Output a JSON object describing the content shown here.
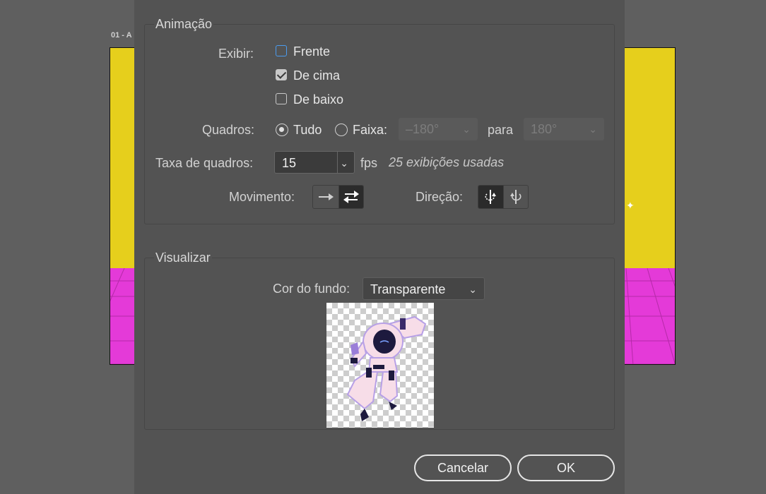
{
  "document": {
    "tab_label": "01 - A"
  },
  "animation": {
    "title": "Animação",
    "show_label": "Exibir:",
    "show_options": [
      {
        "label": "Frente",
        "checked": false
      },
      {
        "label": "De cima",
        "checked": true
      },
      {
        "label": "De baixo",
        "checked": false
      }
    ],
    "frames_label": "Quadros:",
    "frames_all": "Tudo",
    "frames_range": "Faixa:",
    "frames_selected": "Tudo",
    "range_from": "–180°",
    "range_to_label": "para",
    "range_to": "180°",
    "frame_rate_label": "Taxa de quadros:",
    "frame_rate_value": "15",
    "fps_label": "fps",
    "views_used": "25 exibições usadas",
    "motion_label": "Movimento:",
    "motion_options": [
      "arrow-right-icon",
      "swap-arrows-icon"
    ],
    "motion_selected": "swap-arrows-icon",
    "direction_label": "Direção:",
    "direction_options": [
      "rotate-ccw-icon",
      "rotate-cw-icon"
    ],
    "direction_selected": "rotate-ccw-icon"
  },
  "preview": {
    "title": "Visualizar",
    "bg_color_label": "Cor do fundo:",
    "bg_color_value": "Transparente"
  },
  "buttons": {
    "cancel": "Cancelar",
    "ok": "OK"
  },
  "colors": {
    "sky": "#e6cf1c",
    "floor": "#e43ad8",
    "dialog_bg": "#535353",
    "focus": "#4b9cf0"
  }
}
